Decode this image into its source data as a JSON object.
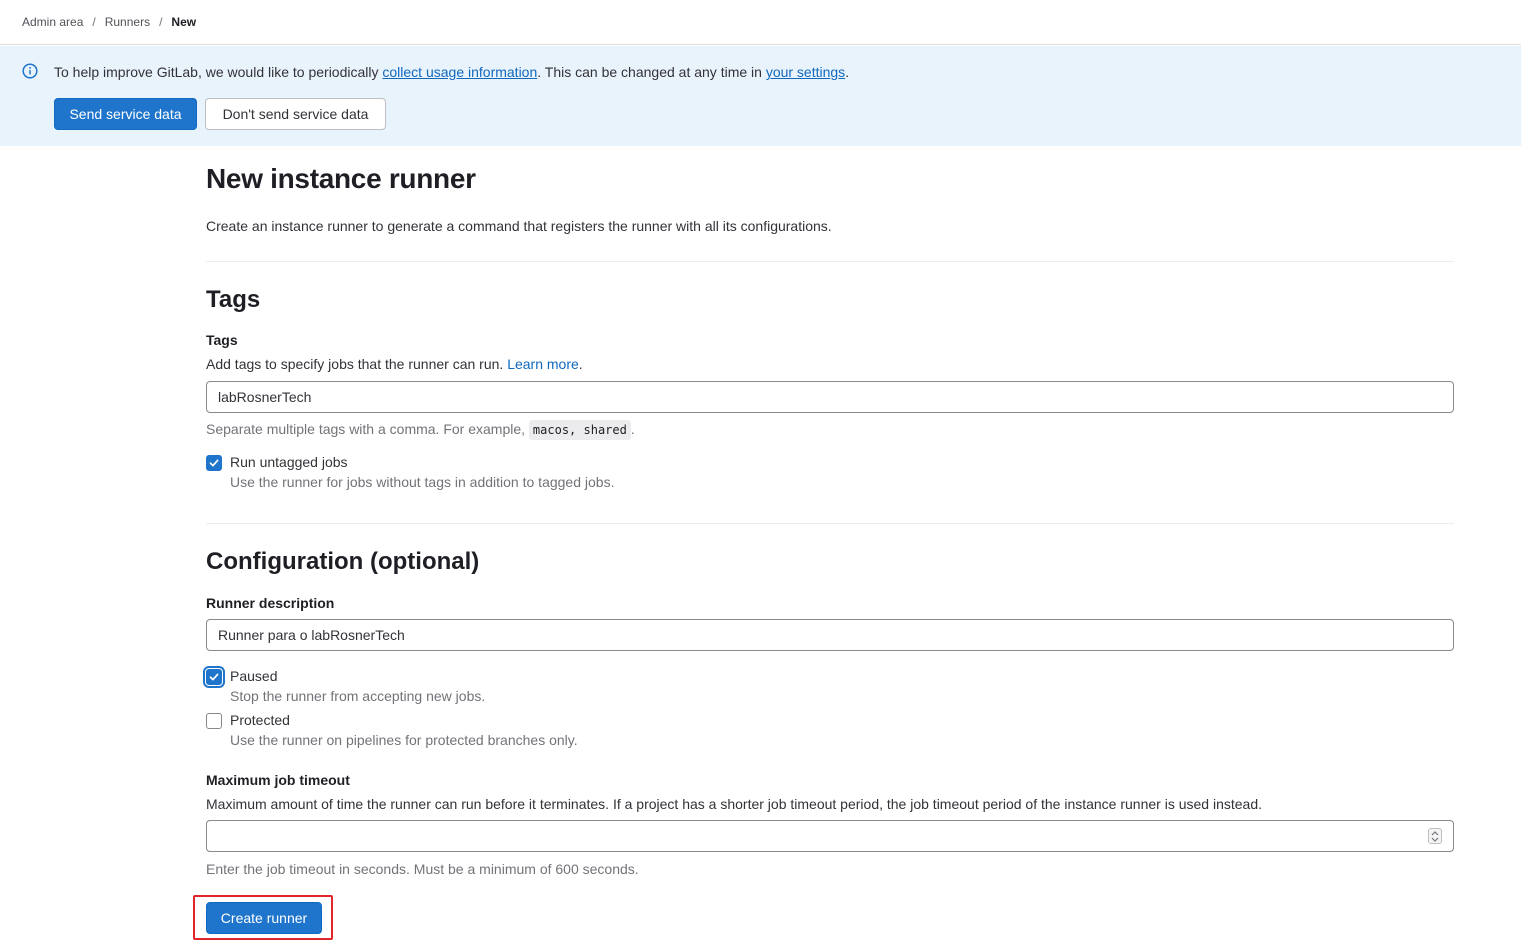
{
  "breadcrumb": {
    "items": [
      "Admin area",
      "Runners"
    ],
    "separator": "/",
    "current": "New"
  },
  "banner": {
    "text_before": "To help improve GitLab, we would like to periodically ",
    "link1": "collect usage information",
    "text_middle": ". This can be changed at any time in ",
    "link2": "your settings",
    "text_after": ".",
    "send_button": "Send service data",
    "dont_send_button": "Don't send service data"
  },
  "page": {
    "title": "New instance runner",
    "description": "Create an instance runner to generate a command that registers the runner with all its configurations."
  },
  "tags_section": {
    "title": "Tags",
    "label": "Tags",
    "description": "Add tags to specify jobs that the runner can run. ",
    "learn_more": "Learn more",
    "description_end": ".",
    "value": "labRosnerTech",
    "help_before": "Separate multiple tags with a comma. For example, ",
    "help_code": "macos, shared",
    "help_after": ".",
    "run_untagged": {
      "label": "Run untagged jobs",
      "help": "Use the runner for jobs without tags in addition to tagged jobs.",
      "checked": true
    }
  },
  "config_section": {
    "title": "Configuration (optional)",
    "description_label": "Runner description",
    "description_value": "Runner para o labRosnerTech",
    "paused": {
      "label": "Paused",
      "help": "Stop the runner from accepting new jobs.",
      "checked": true
    },
    "protected": {
      "label": "Protected",
      "help": "Use the runner on pipelines for protected branches only.",
      "checked": false
    },
    "timeout_label": "Maximum job timeout",
    "timeout_description": "Maximum amount of time the runner can run before it terminates. If a project has a shorter job timeout period, the job timeout period of the instance runner is used instead.",
    "timeout_value": "",
    "timeout_help": "Enter the job timeout in seconds. Must be a minimum of 600 seconds."
  },
  "submit_button": "Create runner",
  "colors": {
    "primary": "#1f75cb",
    "link": "#1068bf",
    "banner_bg": "#e9f3fc",
    "highlight": "#e0262b"
  }
}
